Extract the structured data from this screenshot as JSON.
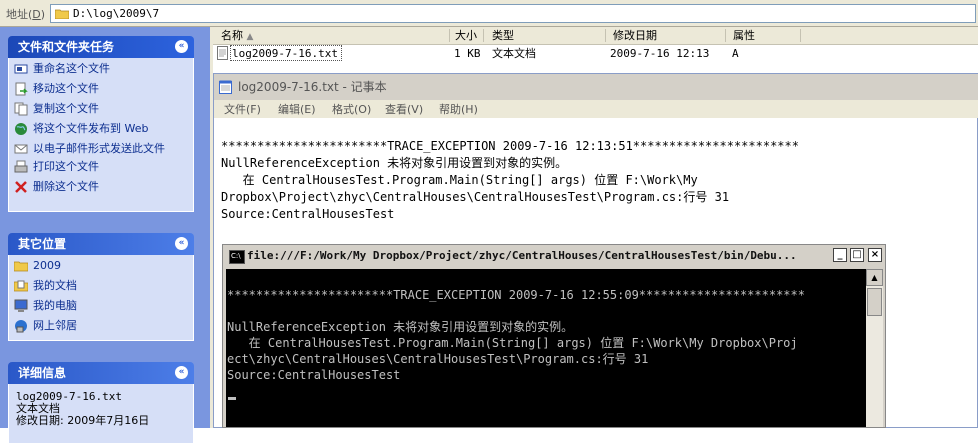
{
  "address": {
    "label": "地址",
    "accel": "D",
    "path": "D:\\log\\2009\\7"
  },
  "taskpane": {
    "file_tasks": {
      "title": "文件和文件夹任务",
      "items": [
        "重命名这个文件",
        "移动这个文件",
        "复制这个文件",
        "将这个文件发布到 Web",
        "以电子邮件形式发送此文件",
        "打印这个文件",
        "删除这个文件"
      ]
    },
    "other_places": {
      "title": "其它位置",
      "items": [
        "2009",
        "我的文档",
        "我的电脑",
        "网上邻居"
      ]
    },
    "details": {
      "title": "详细信息",
      "filename": "log2009-7-16.txt",
      "type": "文本文档",
      "modified": "修改日期: 2009年7月16日"
    }
  },
  "list": {
    "columns": [
      "名称",
      "大小",
      "类型",
      "修改日期",
      "属性"
    ],
    "rows": [
      {
        "name": "log2009-7-16.txt",
        "size": "1 KB",
        "type": "文本文档",
        "modified": "2009-7-16 12:13",
        "attr": "A"
      }
    ]
  },
  "notepad": {
    "title": "log2009-7-16.txt - 记事本",
    "menu": [
      "文件(F)",
      "编辑(E)",
      "格式(O)",
      "查看(V)",
      "帮助(H)"
    ],
    "lines": [
      "***********************TRACE_EXCEPTION 2009-7-16 12:13:51***********************",
      "NullReferenceException 未将对象引用设置到对象的实例。",
      "   在 CentralHousesTest.Program.Main(String[] args) 位置 F:\\Work\\My",
      "Dropbox\\Project\\zhyc\\CentralHouses\\CentralHousesTest\\Program.cs:行号 31",
      "Source:CentralHousesTest"
    ]
  },
  "console": {
    "title": "file:///F:/Work/My Dropbox/Project/zhyc/CentralHouses/CentralHousesTest/bin/Debu...",
    "lines": [
      "***********************TRACE_EXCEPTION 2009-7-16 12:55:09***********************",
      "",
      "NullReferenceException 未将对象引用设置到对象的实例。",
      "   在 CentralHousesTest.Program.Main(String[] args) 位置 F:\\Work\\My Dropbox\\Proj",
      "ect\\zhyc\\CentralHouses\\CentralHousesTest\\Program.cs:行号 31",
      "Source:CentralHousesTest"
    ]
  }
}
